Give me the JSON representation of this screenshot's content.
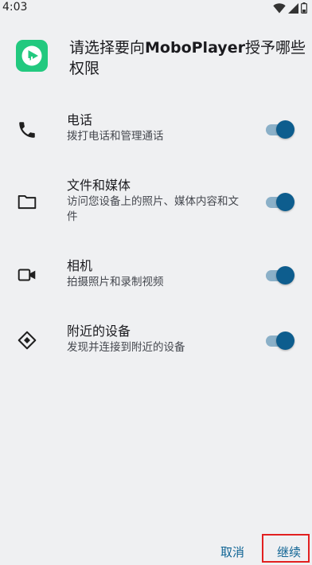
{
  "status_bar": {
    "time": "4:03",
    "icons": [
      "wifi-icon",
      "signal-icon",
      "battery-icon"
    ]
  },
  "header": {
    "app_icon": "moboplayer-app-icon",
    "title_prefix": "请选择要向",
    "title_brand": "MoboPlayer",
    "title_suffix": "授予哪些权限"
  },
  "permissions": [
    {
      "icon": "phone-icon",
      "name": "电话",
      "desc": "拨打电话和管理通话",
      "enabled": true
    },
    {
      "icon": "folder-icon",
      "name": "文件和媒体",
      "desc": "访问您设备上的照片、媒体内容和文件",
      "enabled": true
    },
    {
      "icon": "camera-icon",
      "name": "相机",
      "desc": "拍摄照片和录制视频",
      "enabled": true
    },
    {
      "icon": "nearby-devices-icon",
      "name": "附近的设备",
      "desc": "发现并连接到附近的设备",
      "enabled": true
    }
  ],
  "footer": {
    "cancel_label": "取消",
    "continue_label": "继续"
  },
  "colors": {
    "accent": "#0d5d8e",
    "background": "#eff0f2",
    "app_icon": "#22c97f",
    "highlight": "#e22020"
  }
}
